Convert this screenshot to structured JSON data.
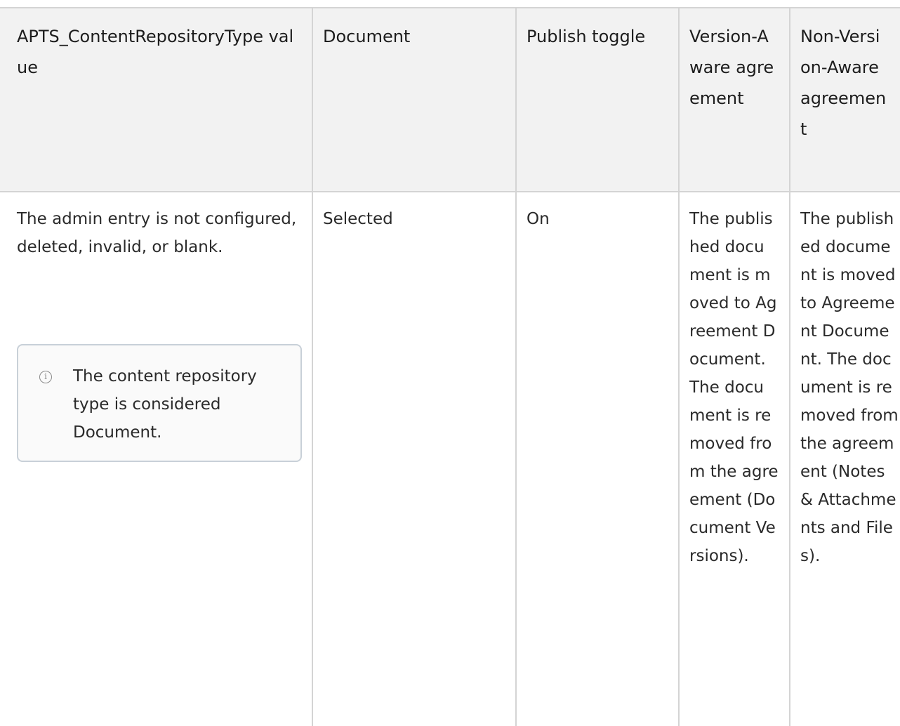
{
  "table": {
    "headers": [
      "APTS_ContentRepositoryType value",
      "Document",
      "Publish toggle",
      "Version-Aware agreement",
      "Non-Version-Aware agreement"
    ],
    "rows": [
      {
        "cells": [
          "The admin entry is not configured, deleted, invalid, or blank.",
          "Selected",
          "On",
          "The published document is moved to Agreement Document. The document is removed from the agreement (Document Versions).",
          "The published document is moved to Agreement Document. The document is removed from the agreement (Notes & Attachments and Files)."
        ],
        "note": {
          "icon": "info-icon",
          "text": "The content repository type is considered Document."
        }
      }
    ]
  }
}
